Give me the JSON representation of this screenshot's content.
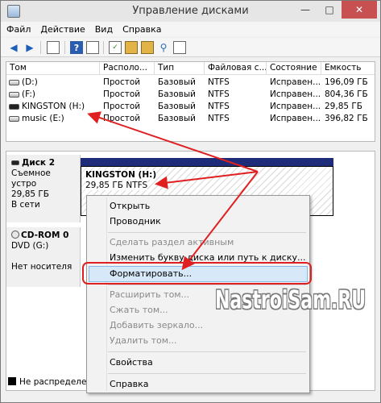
{
  "window": {
    "title": "Управление дисками"
  },
  "menu": [
    "Файл",
    "Действие",
    "Вид",
    "Справка"
  ],
  "table": {
    "columns": [
      "Том",
      "Располо...",
      "Тип",
      "Файловая с...",
      "Состояние",
      "Емкость"
    ],
    "rows": [
      {
        "name": "(D:)",
        "layout": "Простой",
        "type": "Базовый",
        "fs": "NTFS",
        "status": "Исправен...",
        "capacity": "196,09 ГБ"
      },
      {
        "name": "(F:)",
        "layout": "Простой",
        "type": "Базовый",
        "fs": "NTFS",
        "status": "Исправен...",
        "capacity": "804,36 ГБ"
      },
      {
        "name": "KINGSTON (H:)",
        "layout": "Простой",
        "type": "Базовый",
        "fs": "NTFS",
        "status": "Исправен...",
        "capacity": "29,85 ГБ"
      },
      {
        "name": "music (E:)",
        "layout": "Простой",
        "type": "Базовый",
        "fs": "NTFS",
        "status": "Исправен...",
        "capacity": "396,82 ГБ"
      }
    ]
  },
  "disk2": {
    "name": "Диск 2",
    "kind": "Съемное устро",
    "size": "29,85 ГБ",
    "state": "В сети",
    "partition_title": "KINGSTON  (H:)",
    "partition_info": "29,85 ГБ NTFS"
  },
  "cdrom": {
    "name": "CD-ROM 0",
    "drive": "DVD (G:)",
    "state": "Нет носителя"
  },
  "legend": {
    "unallocated": "Не распределен"
  },
  "context_menu": {
    "open": "Открыть",
    "explorer": "Проводник",
    "make_active": "Сделать раздел активным",
    "change_letter": "Изменить букву диска или путь к диску...",
    "format": "Форматировать...",
    "extend": "Расширить том...",
    "shrink": "Сжать том...",
    "add_mirror": "Добавить зеркало...",
    "delete": "Удалить том...",
    "properties": "Свойства",
    "help": "Справка"
  },
  "watermark": "NastroiSam.RU",
  "colors": {
    "partition_bar": "#1e2b79",
    "highlight": "#d7e9f9",
    "annotation": "#e02020"
  }
}
